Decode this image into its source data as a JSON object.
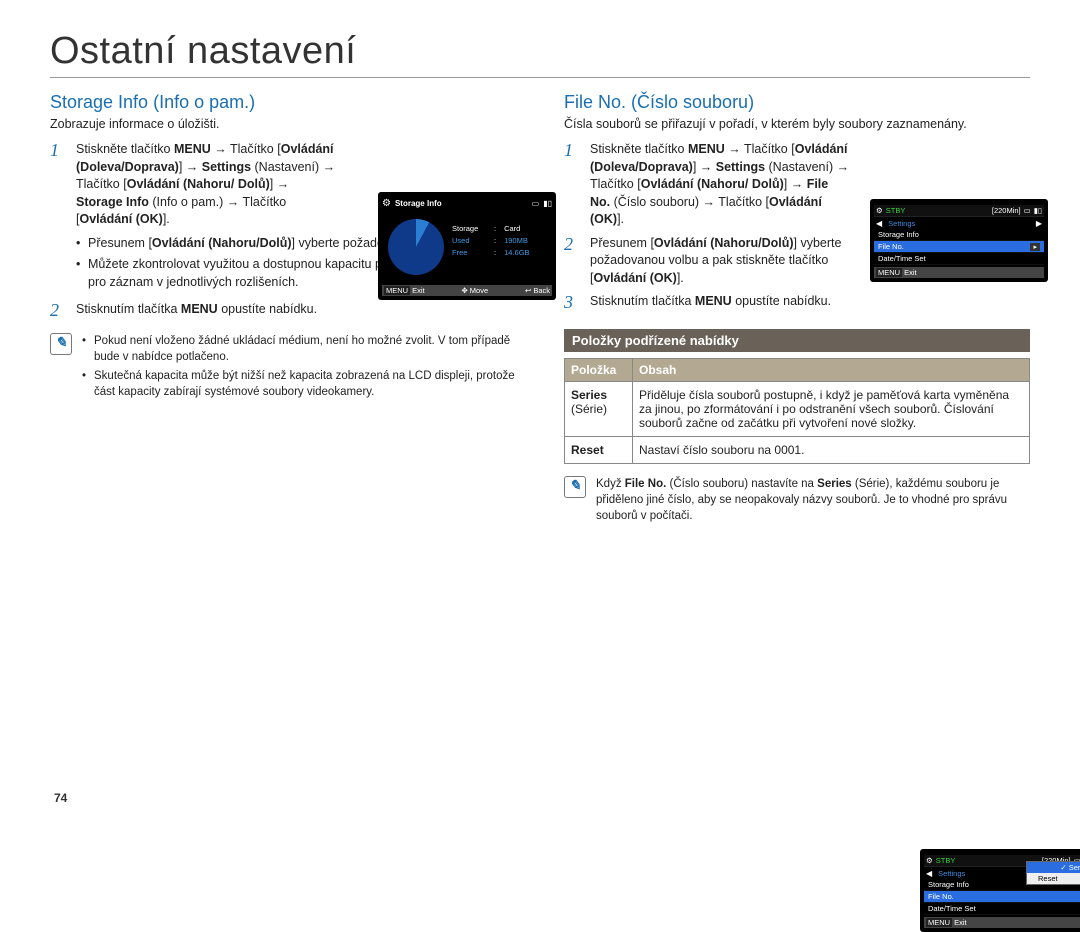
{
  "page_title": "Ostatní nastavení",
  "page_number": "74",
  "left": {
    "heading": "Storage Info (Info o pam.)",
    "intro": "Zobrazuje informace o úložišti.",
    "step1_pre": "Stiskněte tlačítko ",
    "step1_menu": "MENU",
    "step1_arrow": " → Tlačítko [",
    "step1_b1": "Ovládání (Doleva/Doprava)",
    "step1_mid1": "] → ",
    "step1_b2": "Settings",
    "step1_mid2": " (Nastavení) → Tlačítko [",
    "step1_b3": "Ovládání (Nahoru/ Dolů)",
    "step1_mid3": "] → ",
    "step1_b4": "Storage Info",
    "step1_mid4": " (Info o pam.) → Tlačítko [",
    "step1_b5": "Ovládání (OK)",
    "step1_end": "].",
    "bul1_pre": "Přesunem [",
    "bul1_b": "Ovládání (Nahoru/Dolů)",
    "bul1_post": "] vyberte požadovanou informaci.",
    "bul2": "Můžete zkontrolovat využitou a dostupnou kapacitu paměti a dostupný čas pro záznam v jednotlivých rozlišeních.",
    "step2_pre": "Stisknutím tlačítka ",
    "step2_b": "MENU",
    "step2_post": " opustíte nabídku.",
    "note1": "Pokud není vloženo žádné ukládací médium, není ho možné zvolit. V tom případě bude v nabídce potlačeno.",
    "note2": "Skutečná kapacita může být nižší než kapacita zobrazená na LCD displeji, protože část kapacity zabírají systémové soubory videokamery."
  },
  "right": {
    "heading": "File No. (Číslo souboru)",
    "intro": "Čísla souborů se přiřazují v pořadí, v kterém byly soubory zaznamenány.",
    "step1_pre": "Stiskněte tlačítko ",
    "step1_menu": "MENU",
    "step1_arrow": " → Tlačítko [",
    "step1_b1": "Ovládání (Doleva/Doprava)",
    "step1_mid1": "] → ",
    "step1_b2": "Settings",
    "step1_mid2": " (Nastavení) → Tlačítko [",
    "step1_b3": "Ovládání (Nahoru/ Dolů)",
    "step1_mid3": "] → ",
    "step1_b4": "File No.",
    "step1_mid4": " (Číslo souboru) → Tlačítko [",
    "step1_b5": "Ovládání (OK)",
    "step1_end": "].",
    "step2_pre": "Přesunem [",
    "step2_b1": "Ovládání (Nahoru/Dolů)",
    "step2_mid": "] vyberte požadovanou volbu a pak stiskněte tlačítko [",
    "step2_b2": "Ovládání (OK)",
    "step2_end": "].",
    "step3_pre": "Stisknutím tlačítka ",
    "step3_b": "MENU",
    "step3_post": " opustíte nabídku.",
    "sub_heading": "Položky podřízené nabídky",
    "table": {
      "th1": "Položka",
      "th2": "Obsah",
      "r1_name_b": "Series",
      "r1_name_sub": "(Série)",
      "r1_desc": "Přiděluje čísla souborů postupně, i když je paměťová karta vyměněna za jinou, po zformátování i po odstranění všech souborů. Číslování souborů začne od začátku při vytvoření nové složky.",
      "r2_name_b": "Reset",
      "r2_desc": "Nastaví číslo souboru na 0001."
    },
    "note_pre": "Když ",
    "note_b1": "File No.",
    "note_mid1": " (Číslo souboru) nastavíte na ",
    "note_b2": "Series",
    "note_mid2": " (Série), každému souboru je přiděleno jiné číslo, aby se neopakovaly názvy souborů. Je to vhodné pro správu souborů v počítači."
  },
  "lcd": {
    "storage": {
      "title": "Storage Info",
      "row1_l": "Storage",
      "row1_v": "Card",
      "row2_l": "Used",
      "row2_v": "190MB",
      "row3_l": "Free",
      "row3_v": "14.6GB",
      "f_exit": "Exit",
      "f_move": "Move",
      "f_back": "Back",
      "f_exit_key": "MENU"
    },
    "status": {
      "stby": "STBY",
      "time": "[220Min]"
    },
    "menu1": {
      "cat": "Settings",
      "i1": "Storage Info",
      "i2": "File No.",
      "i3": "Date/Time Set",
      "exit": "Exit",
      "exit_key": "MENU"
    },
    "menu2": {
      "cat": "Settings",
      "i1": "Storage Info",
      "i2": "File No.",
      "i3": "Date/Time Set",
      "p1": "Series",
      "p2": "Reset",
      "exit": "Exit",
      "exit_key": "MENU"
    }
  }
}
